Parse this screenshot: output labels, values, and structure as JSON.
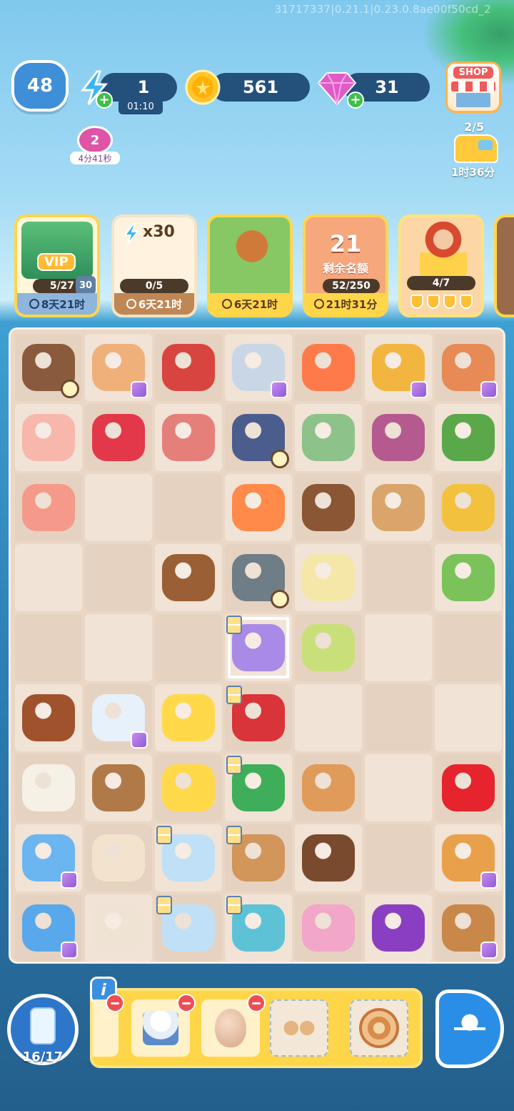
{
  "debug_text": "31717337|0.21.1|0.23.0.8ae00f50cd_2",
  "top_bar": {
    "level": "48",
    "energy": "1",
    "energy_timer": "01:10",
    "coins": "561",
    "gems": "31"
  },
  "boost": {
    "value": "2",
    "timer": "4分41秒"
  },
  "delivery": {
    "count": "2/5",
    "time": "1时36分"
  },
  "cards": [
    {
      "id": "vip",
      "tag": "VIP",
      "progress": "5/27",
      "extra": "30",
      "time": "8天21时"
    },
    {
      "id": "energy-pass",
      "title": "x30",
      "progress": "0/5",
      "time": "6天21时"
    },
    {
      "id": "squirrel",
      "time": "6天21时"
    },
    {
      "id": "cake-event",
      "big": "21",
      "sub": "剩余名额",
      "progress": "52/250",
      "time": "21时31分"
    },
    {
      "id": "chef",
      "progress": "4/7"
    }
  ],
  "board": {
    "rows": [
      [
        "meat-cooler",
        "chicken-box",
        "steak",
        "fishing-rod",
        "salmon",
        "veggie-crate",
        "veggie-basket"
      ],
      [
        "chicken-leg",
        "raw-mince",
        "ham-leg",
        "crab-net",
        "fish",
        "onion-board",
        "spinach-board"
      ],
      [
        "chicken-breast",
        "",
        "",
        "shrimp",
        "mushrooms",
        "potatoes-small",
        "potatoes"
      ],
      [
        "",
        "",
        "hazelnuts",
        "spice-jar",
        "rice-cup",
        "",
        "green-onion-board"
      ],
      [
        "",
        "",
        "",
        "oven",
        "tea-bag",
        "",
        ""
      ],
      [
        "soy-sauce-bowl",
        "milk-bottle",
        "butter",
        "frying-pan",
        "",
        "",
        ""
      ],
      [
        "cream-bowl",
        "ice-cup",
        "butter-block",
        "bbq-grill",
        "caramel-cup",
        "",
        "apple"
      ],
      [
        "drink-cooler",
        "coffee-cup",
        "glass-bowl",
        "cutting-station",
        "chocolate-jar",
        "",
        "fruit-basket"
      ],
      [
        "ice-box",
        "latte-cup",
        "glass-bowl-2",
        "blender",
        "sprinkles-bowl",
        "grapes",
        "fruit-basket-2"
      ]
    ]
  },
  "bottom": {
    "info": "i",
    "fridge_count": "16/17",
    "tray_items": [
      "cream-cup",
      "egg",
      "rolls",
      "cinnamon-roll"
    ]
  },
  "colors": {
    "board_bg": "#ead7c5",
    "card_border": "#ffd64a",
    "pill_bg": "#24507c"
  }
}
